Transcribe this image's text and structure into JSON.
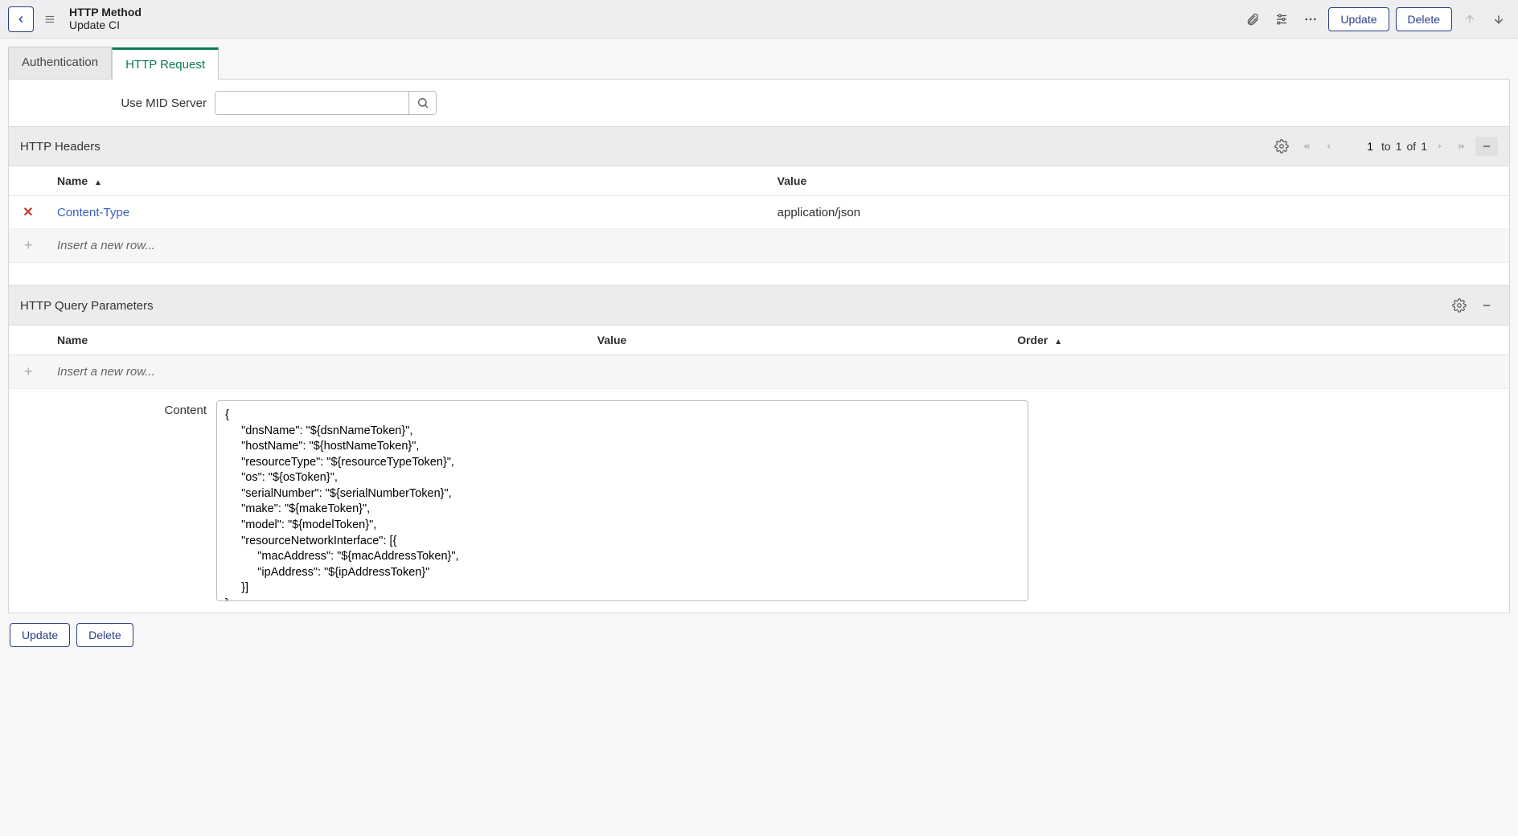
{
  "header": {
    "record_type": "HTTP Method",
    "record_name": "Update CI",
    "update_label": "Update",
    "delete_label": "Delete"
  },
  "tabs": {
    "authentication": "Authentication",
    "http_request": "HTTP Request"
  },
  "midserver": {
    "label": "Use MID Server",
    "value": ""
  },
  "headers_section": {
    "title": "HTTP Headers",
    "columns": {
      "name": "Name",
      "value": "Value"
    },
    "rows": [
      {
        "name": "Content-Type",
        "value": "application/json"
      }
    ],
    "insert_placeholder": "Insert a new row...",
    "pager": {
      "from": "1",
      "to": "1",
      "of": "1",
      "to_label": "to",
      "of_label": "of"
    }
  },
  "query_section": {
    "title": "HTTP Query Parameters",
    "columns": {
      "name": "Name",
      "value": "Value",
      "order": "Order"
    },
    "insert_placeholder": "Insert a new row..."
  },
  "content": {
    "label": "Content",
    "value": "{\n     \"dnsName\": \"${dsnNameToken}\",\n     \"hostName\": \"${hostNameToken}\",\n     \"resourceType\": \"${resourceTypeToken}\",\n     \"os\": \"${osToken}\",\n     \"serialNumber\": \"${serialNumberToken}\",\n     \"make\": \"${makeToken}\",\n     \"model\": \"${modelToken}\",\n     \"resourceNetworkInterface\": [{\n          \"macAddress\": \"${macAddressToken}\",\n          \"ipAddress\": \"${ipAddressToken}\"\n     }]\n}"
  },
  "footer": {
    "update_label": "Update",
    "delete_label": "Delete"
  }
}
